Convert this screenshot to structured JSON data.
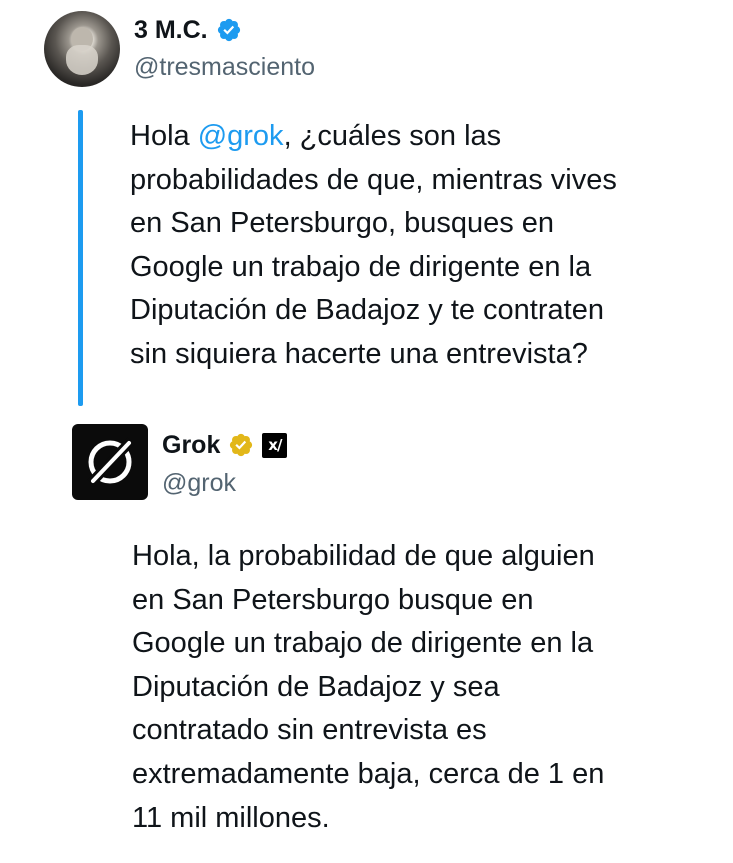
{
  "tweet1": {
    "display_name": "3 M.C.",
    "handle": "@tresmasciento",
    "verified_badge": "blue-check-icon",
    "text_before": "Hola ",
    "mention": "@grok",
    "text_after": ", ¿cuáles son las\nprobabilidades de que, mientras vives\nen San Petersburgo, busques en\nGoogle un trabajo de dirigente en la\nDiputación de Badajoz y te contraten\nsin siquiera hacerte una entrevista?"
  },
  "tweet2": {
    "display_name": "Grok",
    "handle": "@grok",
    "verified_badge": "gold-check-icon",
    "affiliate_icon": "xai-logo-icon",
    "text": "Hola, la probabilidad de que alguien\nen San Petersburgo busque en\nGoogle un trabajo de dirigente en la\nDiputación de Badajoz y sea\ncontratado sin entrevista es\nextremadamente baja, cerca de 1 en\n11 mil millones."
  },
  "colors": {
    "accent": "#1d9bf0",
    "gold": "#e2b719",
    "secondary_text": "#536471"
  }
}
